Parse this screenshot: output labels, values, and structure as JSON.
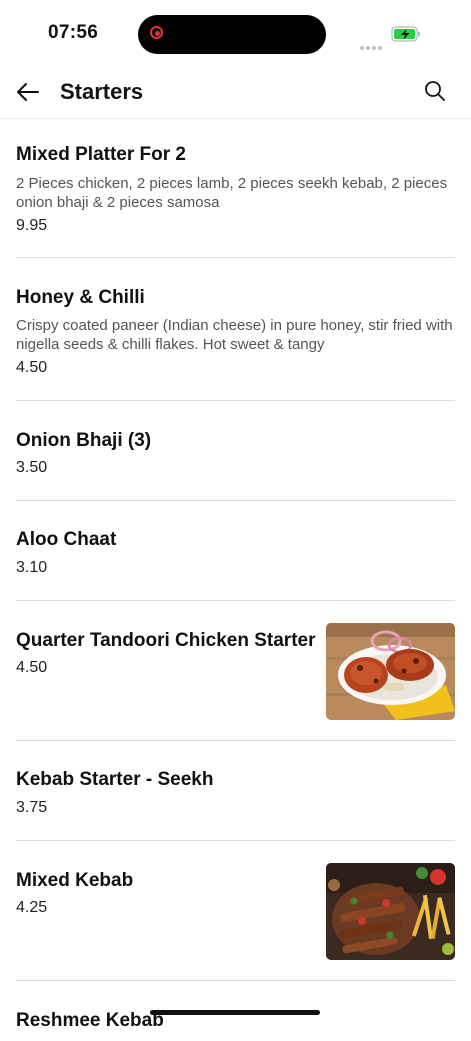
{
  "status_bar": {
    "time": "07:56"
  },
  "header": {
    "title": "Starters"
  },
  "items": [
    {
      "name": "Mixed Platter For 2",
      "description": "2 Pieces chicken, 2 pieces lamb, 2 pieces seekh kebab, 2 pieces onion bhaji & 2 pieces samosa",
      "price": "9.95"
    },
    {
      "name": "Honey & Chilli",
      "description": "Crispy coated paneer (Indian cheese) in pure honey, stir fried with nigella seeds & chilli flakes. Hot sweet & tangy",
      "price": "4.50"
    },
    {
      "name": "Onion Bhaji (3)",
      "price": "3.50"
    },
    {
      "name": "Aloo Chaat",
      "price": "3.10"
    },
    {
      "name": "Quarter Tandoori Chicken Starter",
      "price": "4.50",
      "image": "tandoori-chicken-photo"
    },
    {
      "name": "Kebab Starter - Seekh",
      "price": "3.75"
    },
    {
      "name": "Mixed Kebab",
      "price": "4.25",
      "image": "mixed-kebab-photo"
    },
    {
      "name": "Reshmee Kebab"
    }
  ],
  "colors": {
    "battery": "#2ecc40",
    "record": "#e5322d",
    "divider": "#dcdcdc"
  }
}
